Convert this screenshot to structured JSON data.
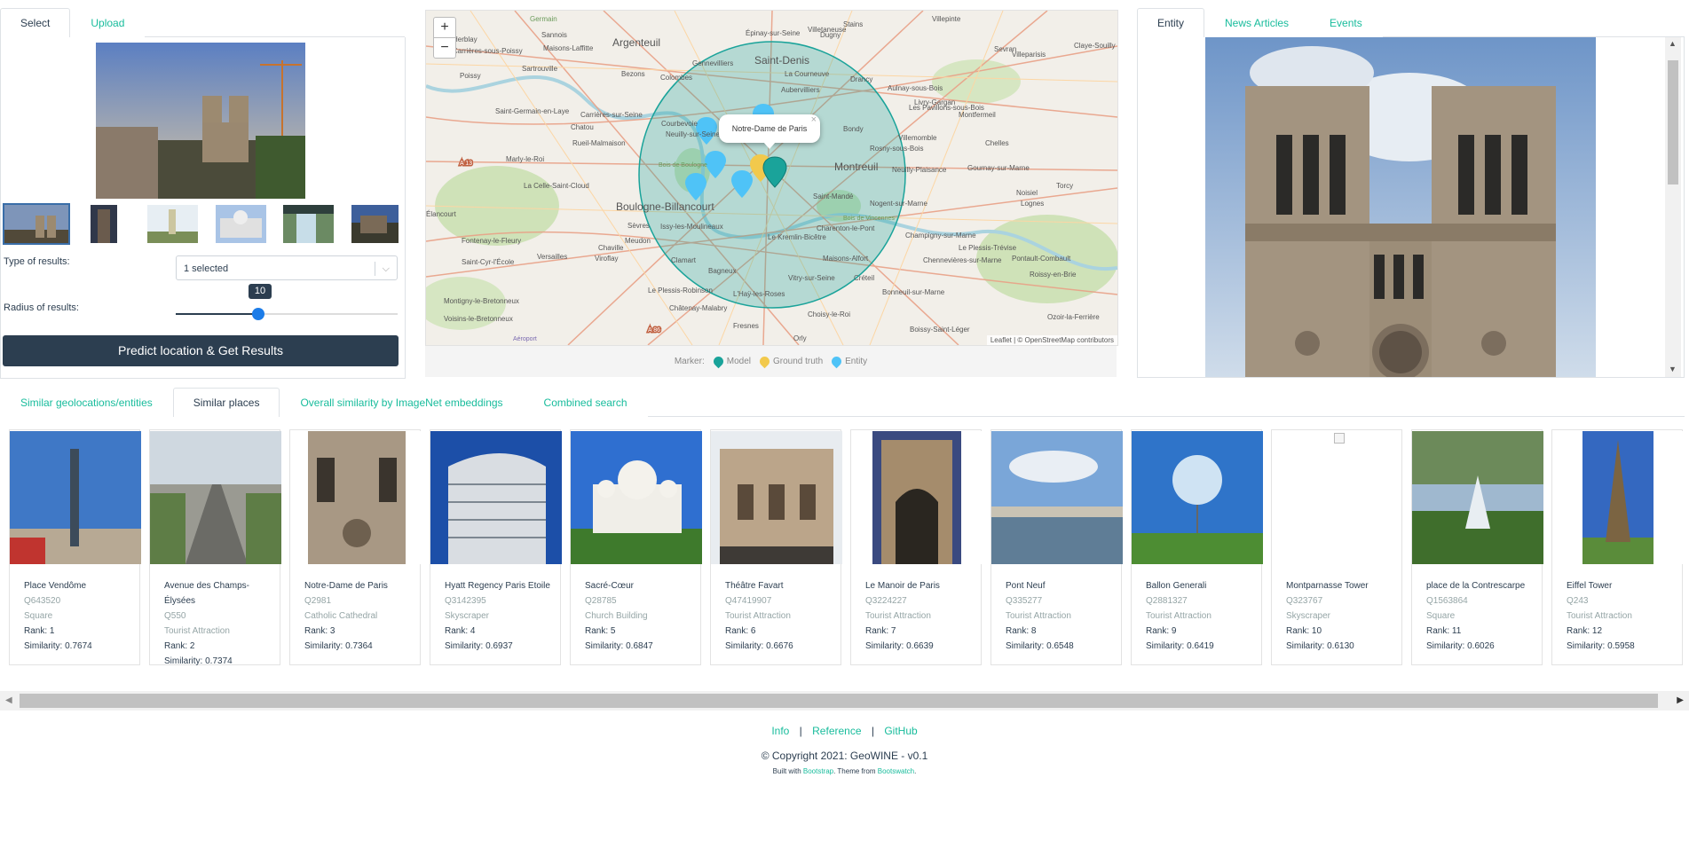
{
  "left_tabs": [
    "Select",
    "Upload"
  ],
  "type_of_results": {
    "label": "Type of results:",
    "value": "1 selected"
  },
  "radius": {
    "label": "Radius of results:",
    "value": "10"
  },
  "predict_button": "Predict location & Get Results",
  "map": {
    "zoom_in": "+",
    "zoom_out": "−",
    "popup": "Notre-Dame de Paris",
    "popup_close": "×",
    "places": [
      "Argenteuil",
      "Saint-Denis",
      "Épinay-sur-Seine",
      "Villetaneuse",
      "Stains",
      "Dugny",
      "Villepinte",
      "Germain",
      "Herblay",
      "Sannois",
      "Maisons-Laffitte",
      "Sartrouville",
      "Colombes",
      "Bezons",
      "Gennevilliers",
      "Aubervilliers",
      "La Courneuve",
      "Drancy",
      "Aulnay-sous-Bois",
      "Sevran",
      "Villeparisis",
      "Claye-Souilly",
      "Carrières-sous-Poissy",
      "Poissy",
      "Saint-Germain-en-Laye",
      "Chatou",
      "Rueil-Malmaison",
      "Courbevoie",
      "Neuilly-sur-Seine",
      "Bondy",
      "Les Pavillons-sous-Bois",
      "Livry-Gargan",
      "Montfermeil",
      "Marly-le-Roi",
      "Montreuil",
      "Rosny-sous-Bois",
      "Villemomble",
      "Chelles",
      "Neuilly-Plaisance",
      "Gournay-sur-Marne",
      "Boulogne-Billancourt",
      "Saint-Mandé",
      "Nogent-sur-Marne",
      "Noisiel",
      "Lognes",
      "Torcy",
      "La Celle-Saint-Cloud",
      "Sèvres",
      "Issy-les-Moulineaux",
      "Vincennes",
      "Champigny-sur-Marne",
      "Le Plessis-Trévise",
      "Pontault-Combault",
      "Versailles",
      "Viroflay",
      "Chaville",
      "Le Kremlin-Bicêtre",
      "Charenton-le-Pont",
      "Maisons-Alfort",
      "Chennevières-sur-Marne",
      "Meudon",
      "Clamart",
      "Bagneux",
      "Créteil",
      "Roissy-en-Brie",
      "Saint-Cyr-l'École",
      "L'Haÿ-les-Roses",
      "Vitry-sur-Seine",
      "Le Plessis-Robinson",
      "Châtenay-Malabry",
      "Choisy-le-Roi",
      "Bonneuil-sur-Marne",
      "Ozoir-la-Ferrière",
      "Montigny-le-Bretonneux",
      "Voisins-le-Bretonneux",
      "Fresnes",
      "Boissy-Saint-Léger",
      "Fontenay-le-Fleury",
      "Élancourt",
      "Aéroport",
      "Orly",
      "Bois de Boulogne",
      "Bois de Vincennes",
      "Carrières-sur-Seine",
      "A 13",
      "A 86"
    ],
    "attribution": "Leaflet | © OpenStreetMap contributors"
  },
  "legend": {
    "title": "Marker:",
    "model": "Model",
    "ground_truth": "Ground truth",
    "entity": "Entity",
    "colors": {
      "model": "#1aa39a",
      "ground_truth": "#f2c94c",
      "entity": "#4fc3f7"
    }
  },
  "right_tabs": [
    "Entity",
    "News Articles",
    "Events"
  ],
  "result_tabs": [
    "Similar geolocations/entities",
    "Similar places",
    "Overall similarity by ImageNet embeddings",
    "Combined search"
  ],
  "cards": [
    {
      "name": "Place Vendôme",
      "qid": "Q643520",
      "type": "Square",
      "rank": "Rank: 1",
      "sim": "Similarity: 0.7674"
    },
    {
      "name": "Avenue des Champs-Élysées",
      "qid": "Q550",
      "type": "Tourist Attraction",
      "rank": "Rank: 2",
      "sim": "Similarity: 0.7374"
    },
    {
      "name": "Notre-Dame de Paris",
      "qid": "Q2981",
      "type": "Catholic Cathedral",
      "rank": "Rank: 3",
      "sim": "Similarity: 0.7364"
    },
    {
      "name": "Hyatt Regency Paris Etoile",
      "qid": "Q3142395",
      "type": "Skyscraper",
      "rank": "Rank: 4",
      "sim": "Similarity: 0.6937"
    },
    {
      "name": "Sacré-Cœur",
      "qid": "Q28785",
      "type": "Church Building",
      "rank": "Rank: 5",
      "sim": "Similarity: 0.6847"
    },
    {
      "name": "Théâtre Favart",
      "qid": "Q47419907",
      "type": "Tourist Attraction",
      "rank": "Rank: 6",
      "sim": "Similarity: 0.6676"
    },
    {
      "name": "Le Manoir de Paris",
      "qid": "Q3224227",
      "type": "Tourist Attraction",
      "rank": "Rank: 7",
      "sim": "Similarity: 0.6639"
    },
    {
      "name": "Pont Neuf",
      "qid": "Q335277",
      "type": "Tourist Attraction",
      "rank": "Rank: 8",
      "sim": "Similarity: 0.6548"
    },
    {
      "name": "Ballon Generali",
      "qid": "Q2881327",
      "type": "Tourist Attraction",
      "rank": "Rank: 9",
      "sim": "Similarity: 0.6419"
    },
    {
      "name": "Montparnasse Tower",
      "qid": "Q323767",
      "type": "Skyscraper",
      "rank": "Rank: 10",
      "sim": "Similarity: 0.6130"
    },
    {
      "name": "place de la Contrescarpe",
      "qid": "Q1563864",
      "type": "Square",
      "rank": "Rank: 11",
      "sim": "Similarity: 0.6026"
    },
    {
      "name": "Eiffel Tower",
      "qid": "Q243",
      "type": "Tourist Attraction",
      "rank": "Rank: 12",
      "sim": "Similarity: 0.5958"
    }
  ],
  "footer": {
    "links": [
      "Info",
      "Reference",
      "GitHub"
    ],
    "separator": "|",
    "copyright": "© Copyright 2021: GeoWINE - v0.1",
    "built_prefix": "Built with ",
    "bootstrap": "Bootstrap",
    "built_mid": ". Theme from ",
    "bootswatch": "Bootswatch",
    "built_suffix": "."
  }
}
